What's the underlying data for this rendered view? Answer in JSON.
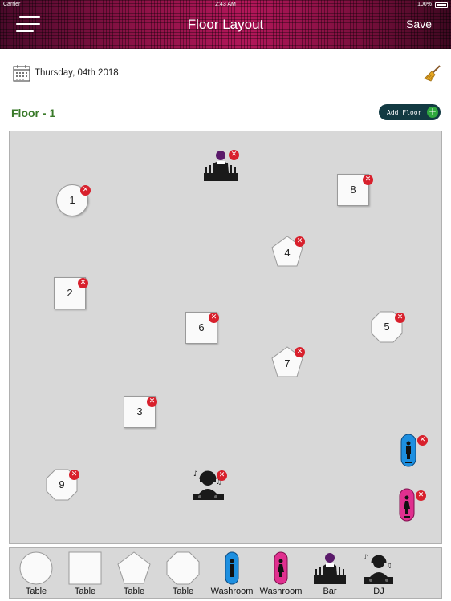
{
  "status_bar": {
    "carrier": "Carrier",
    "time": "2:43 AM",
    "battery": "100%"
  },
  "header": {
    "title": "Floor Layout",
    "save_label": "Save"
  },
  "date": {
    "text": "Thursday, 04th 2018"
  },
  "floor": {
    "label": "Floor -  1",
    "add_label": "Add Floor"
  },
  "tables": [
    {
      "number": "1",
      "shape": "circle"
    },
    {
      "number": "8",
      "shape": "square"
    },
    {
      "number": "4",
      "shape": "pentagon"
    },
    {
      "number": "2",
      "shape": "square"
    },
    {
      "number": "6",
      "shape": "square"
    },
    {
      "number": "5",
      "shape": "octagon"
    },
    {
      "number": "7",
      "shape": "pentagon"
    },
    {
      "number": "3",
      "shape": "square"
    },
    {
      "number": "9",
      "shape": "octagon"
    }
  ],
  "palette": [
    {
      "label": "Table",
      "shape": "circle"
    },
    {
      "label": "Table",
      "shape": "square"
    },
    {
      "label": "Table",
      "shape": "pentagon"
    },
    {
      "label": "Table",
      "shape": "octagon"
    },
    {
      "label": "Washroom",
      "shape": "washroom-men"
    },
    {
      "label": "Washroom",
      "shape": "washroom-women"
    },
    {
      "label": "Bar",
      "shape": "bar"
    },
    {
      "label": "DJ",
      "shape": "dj"
    }
  ],
  "colors": {
    "accent_green": "#3a7a2a",
    "delete_red": "#d8202c",
    "add_button_bg": "#123a42",
    "washroom_men": "#1d8fe0",
    "washroom_women": "#e0308f"
  }
}
